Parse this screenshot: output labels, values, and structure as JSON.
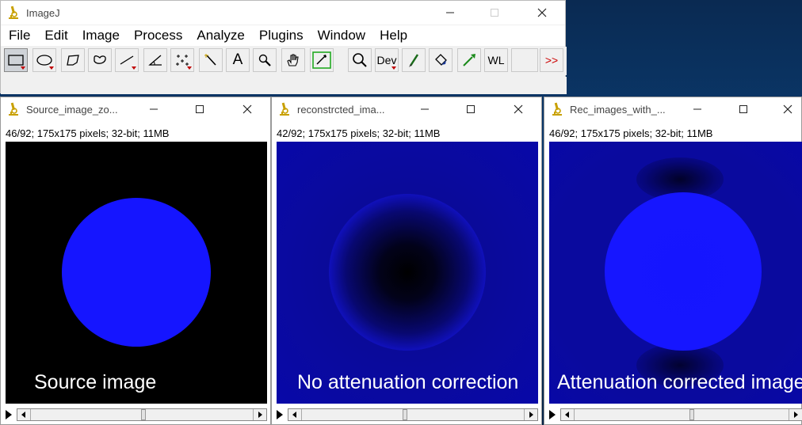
{
  "main_window": {
    "title": "ImageJ",
    "menu": [
      "File",
      "Edit",
      "Image",
      "Process",
      "Analyze",
      "Plugins",
      "Window",
      "Help"
    ],
    "toolbar": {
      "dev_label": "Dev",
      "wl_label": "WL",
      "text_tool_label": "A",
      "more_label": ">>"
    }
  },
  "windows": [
    {
      "title": "Source_image_zo...",
      "info": "46/92; 175x175 pixels; 32-bit; 11MB",
      "caption": "Source image"
    },
    {
      "title": "reconstrcted_ima...",
      "info": "42/92; 175x175 pixels; 32-bit; 11MB",
      "caption": "No attenuation correction"
    },
    {
      "title": "Rec_images_with_...",
      "info": "46/92; 175x175 pixels; 32-bit; 11MB",
      "caption": "Attenuation corrected image"
    }
  ],
  "colors": {
    "image_blue": "#1515ff",
    "recon_background": "#0a0a9a",
    "selected_tool_outline": "#22aa22",
    "more_arrows": "#cc0000"
  },
  "icons": [
    "imagej-microscope-icon",
    "minimize-icon",
    "maximize-icon",
    "close-icon"
  ]
}
